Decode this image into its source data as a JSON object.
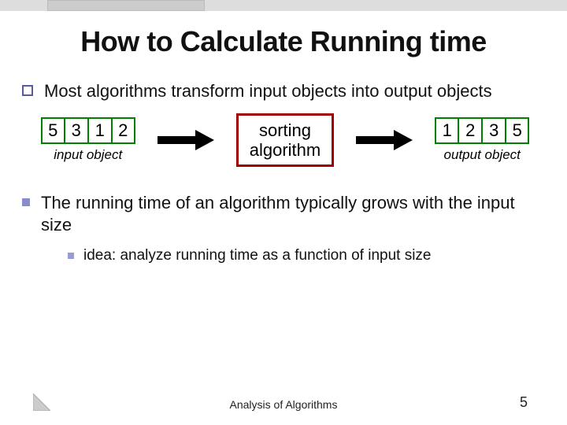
{
  "slide": {
    "title": "How to Calculate Running time",
    "bullet1": "Most algorithms transform input objects into output objects",
    "bullet2": "The running time of an algorithm typically grows with the input size",
    "bullet2_sub": "idea: analyze running time as a function of input size"
  },
  "diagram": {
    "input_cells": [
      "5",
      "3",
      "1",
      "2"
    ],
    "input_label": "input object",
    "center_line1": "sorting",
    "center_line2": "algorithm",
    "output_cells": [
      "1",
      "2",
      "3",
      "5"
    ],
    "output_label": "output object"
  },
  "footer": {
    "center": "Analysis of Algorithms",
    "page": "5"
  }
}
